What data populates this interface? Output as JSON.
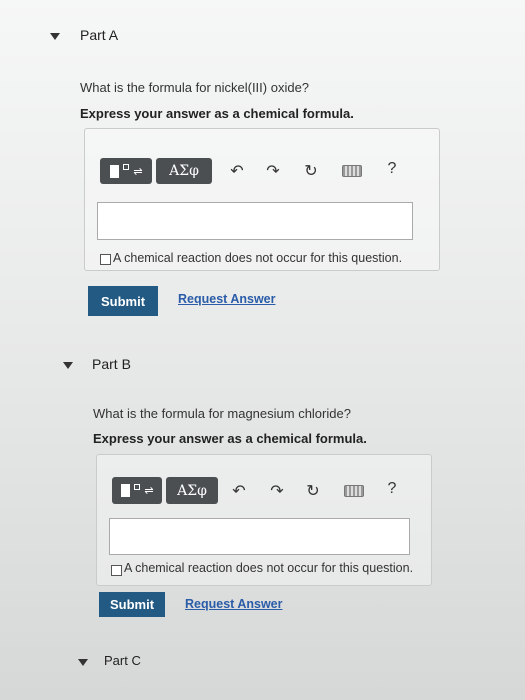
{
  "partA": {
    "title": "Part A",
    "question": "What is the formula for nickel(III) oxide?",
    "instruction": "Express your answer as a chemical formula.",
    "toolbar": {
      "greek_label": "ΑΣφ",
      "help_label": "?"
    },
    "checkbox_label": "A chemical reaction does not occur for this question.",
    "submit_label": "Submit",
    "request_label": "Request Answer"
  },
  "partB": {
    "title": "Part B",
    "question": "What is the formula for magnesium chloride?",
    "instruction": "Express your answer as a chemical formula.",
    "toolbar": {
      "greek_label": "ΑΣφ",
      "help_label": "?"
    },
    "checkbox_label": "A chemical reaction does not occur for this question.",
    "submit_label": "Submit",
    "request_label": "Request Answer"
  },
  "partC": {
    "title": "Part C"
  },
  "icons": {
    "caret": "caret-down-icon",
    "templates": "templates-icon",
    "undo": "undo-icon",
    "redo": "redo-icon",
    "reset": "reset-icon",
    "keyboard": "keyboard-icon",
    "help": "help-icon"
  },
  "colors": {
    "submit_bg": "#235a84",
    "link": "#2a5ca8",
    "toolbar_btn": "#4c4f52"
  }
}
